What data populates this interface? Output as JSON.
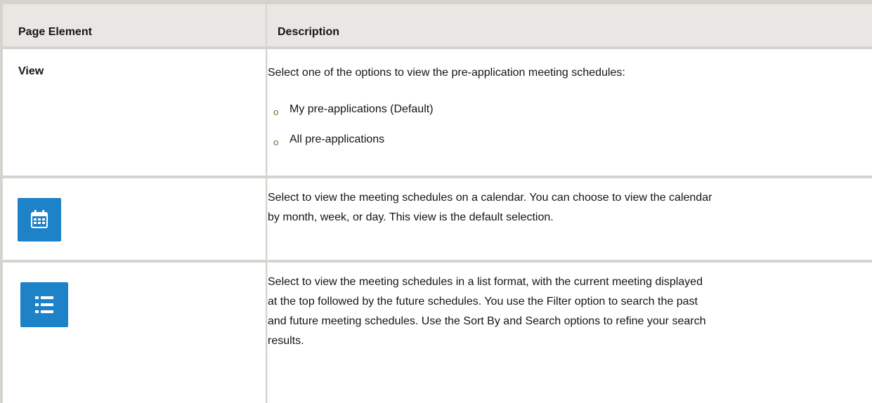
{
  "table": {
    "headers": {
      "element": "Page Element",
      "description": "Description"
    },
    "rows": [
      {
        "element": "View",
        "description": "Select one of the options to view the pre-application meeting schedules:",
        "options": [
          "My pre-applications (Default)",
          "All pre-applications"
        ]
      },
      {
        "icon": "calendar-icon",
        "description_line1": "Select to view the meeting schedules on a calendar. You can choose to view the calendar",
        "description_line2": "by month, week, or day. This view is the default selection."
      },
      {
        "icon": "list-icon",
        "description_line1": "Select to view the meeting schedules in a list format, with the current meeting displayed",
        "description_line2": "at the top followed by the future schedules. You use the Filter option to search the past",
        "description_line3": "and future meeting schedules. Use the Sort By and Search options to refine your search",
        "description_line4": "results."
      }
    ]
  },
  "colors": {
    "header_bg": "#e9e7e3",
    "border": "#d6d3ce",
    "icon_blue": "#1e82c8",
    "bullet": "#4a7c2e"
  }
}
